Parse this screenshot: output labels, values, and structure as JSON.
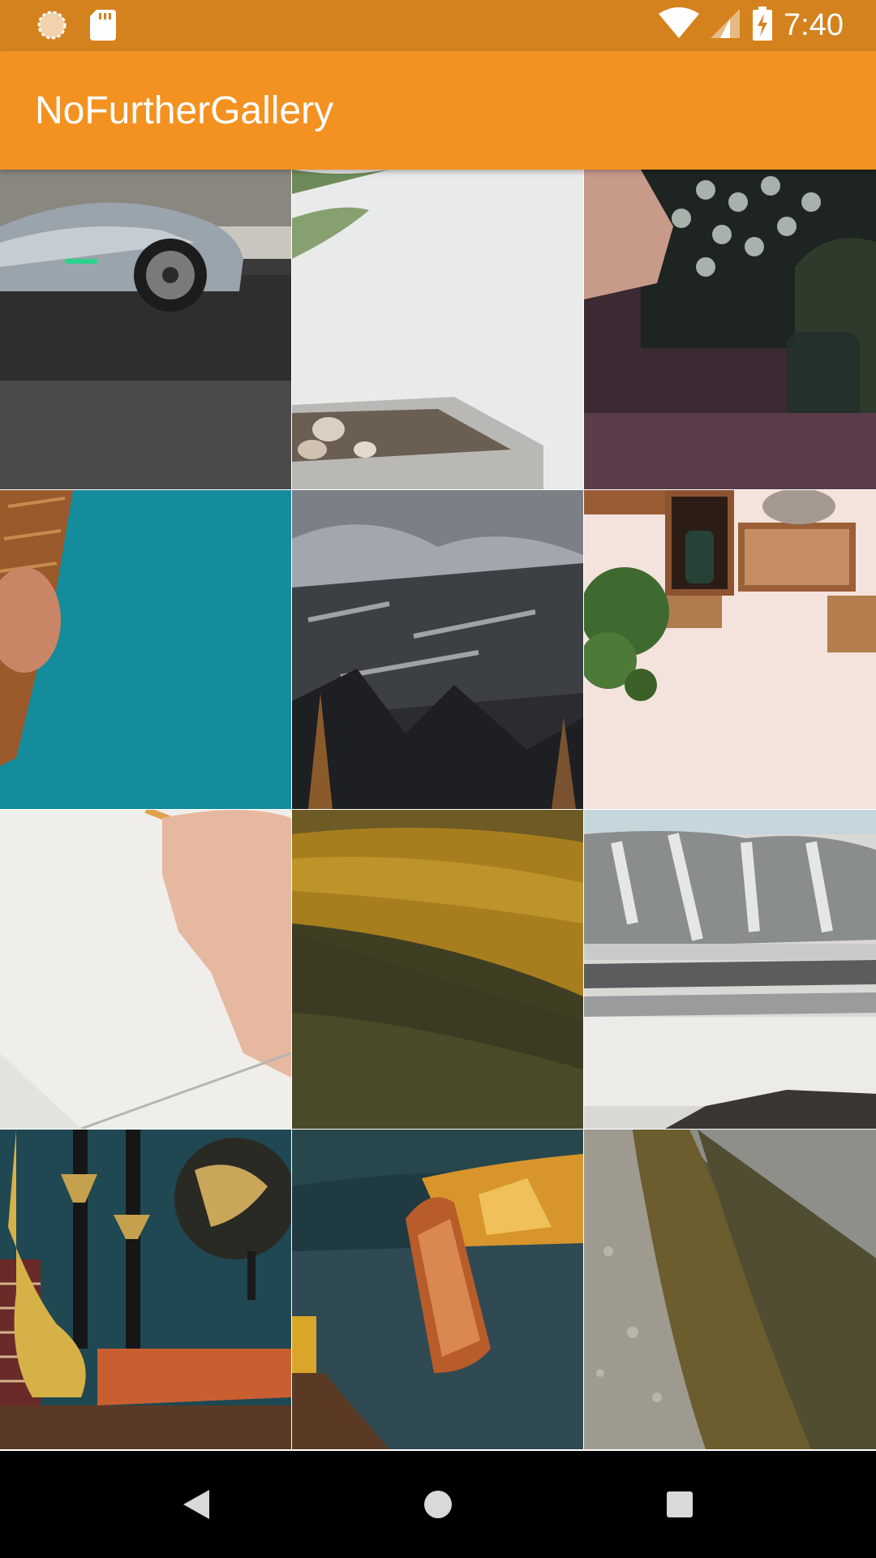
{
  "status_bar": {
    "time": "7:40",
    "icons": [
      "loading-spinner-icon",
      "sd-card-icon",
      "wifi-icon",
      "cell-signal-icon",
      "battery-charging-icon"
    ]
  },
  "app_bar": {
    "title": "NoFurtherGallery"
  },
  "gallery": {
    "photos": [
      {
        "subject": "silver sports car"
      },
      {
        "subject": "potted plant with pebbles"
      },
      {
        "subject": "hand on typewriter"
      },
      {
        "subject": "ice cream cone on teal"
      },
      {
        "subject": "frosted forest mountainside"
      },
      {
        "subject": "wooden crate shelves with plant"
      },
      {
        "subject": "hand drawing with pencil"
      },
      {
        "subject": "golden grassy hills"
      },
      {
        "subject": "snowy cliffs and shore"
      },
      {
        "subject": "golden candlesticks and globe"
      },
      {
        "subject": "wooden boat on lake"
      },
      {
        "subject": "rocky mountain trail"
      }
    ]
  },
  "nav_bar": {
    "buttons": [
      "back-icon",
      "home-icon",
      "recents-icon"
    ]
  },
  "colors": {
    "status_bar": "#d4821e",
    "app_bar": "#f39221",
    "nav_bar": "#000000"
  }
}
